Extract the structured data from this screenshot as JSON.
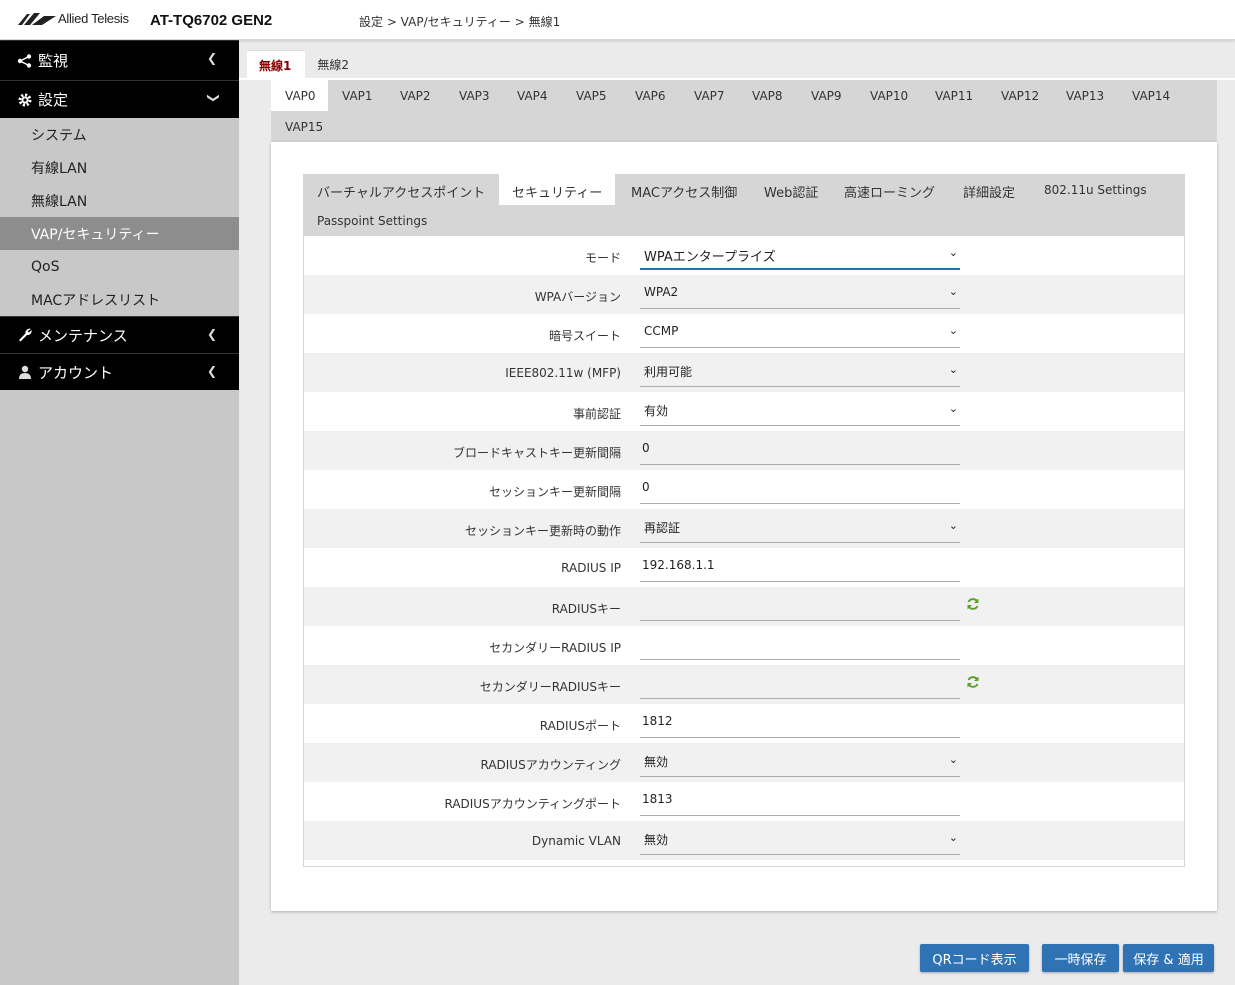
{
  "header": {
    "brand": "Allied Telesis",
    "product": "AT-TQ6702 GEN2",
    "breadcrumb": "設定 > VAP/セキュリティー > 無線1"
  },
  "sidebar": {
    "sections": [
      {
        "label": "監視",
        "icon": "share-icon"
      },
      {
        "label": "設定",
        "icon": "gear-icon"
      }
    ],
    "items": [
      "システム",
      "有線LAN",
      "無線LAN",
      "VAP/セキュリティー",
      "QoS",
      "MACアドレスリスト"
    ],
    "sections2": [
      {
        "label": "メンテナンス",
        "icon": "wrench-icon"
      },
      {
        "label": "アカウント",
        "icon": "user-icon"
      }
    ]
  },
  "radio_tabs": [
    "無線1",
    "無線2"
  ],
  "vap_tabs": [
    "VAP0",
    "VAP1",
    "VAP2",
    "VAP3",
    "VAP4",
    "VAP5",
    "VAP6",
    "VAP7",
    "VAP8",
    "VAP9",
    "VAP10",
    "VAP11",
    "VAP12",
    "VAP13",
    "VAP14",
    "VAP15"
  ],
  "sub_tabs": [
    "バーチャルアクセスポイント",
    "セキュリティー",
    "MACアクセス制御",
    "Web認証",
    "高速ローミング",
    "詳細設定",
    "802.11u Settings",
    "Passpoint Settings"
  ],
  "form": [
    {
      "label": "モード",
      "value": "WPAエンタープライズ",
      "type": "select"
    },
    {
      "label": "WPAバージョン",
      "value": "WPA2",
      "type": "select"
    },
    {
      "label": "暗号スイート",
      "value": "CCMP",
      "type": "select"
    },
    {
      "label": "IEEE802.11w (MFP)",
      "value": "利用可能",
      "type": "select"
    },
    {
      "label": "事前認証",
      "value": "有効",
      "type": "select"
    },
    {
      "label": "ブロードキャストキー更新間隔",
      "value": "0",
      "type": "input"
    },
    {
      "label": "セッションキー更新間隔",
      "value": "0",
      "type": "input"
    },
    {
      "label": "セッションキー更新時の動作",
      "value": "再認証",
      "type": "select"
    },
    {
      "label": "RADIUS IP",
      "value": "192.168.1.1",
      "type": "input"
    },
    {
      "label": "RADIUSキー",
      "value": "",
      "type": "input"
    },
    {
      "label": "セカンダリーRADIUS IP",
      "value": "",
      "type": "input"
    },
    {
      "label": "セカンダリーRADIUSキー",
      "value": "",
      "type": "input"
    },
    {
      "label": "RADIUSポート",
      "value": "1812",
      "type": "input"
    },
    {
      "label": "RADIUSアカウンティング",
      "value": "無効",
      "type": "select"
    },
    {
      "label": "RADIUSアカウンティングポート",
      "value": "1813",
      "type": "input"
    },
    {
      "label": "Dynamic VLAN",
      "value": "無効",
      "type": "select"
    }
  ],
  "buttons": {
    "qr": "QRコード表示",
    "temp_save": "一時保存",
    "save_apply": "保存 & 適用"
  },
  "colors": {
    "accent": "#2f73b5",
    "active_radio_tab": "#8b0000",
    "sidebar_active": "#8d8d8d",
    "refresh_icon": "#5aa02c"
  }
}
